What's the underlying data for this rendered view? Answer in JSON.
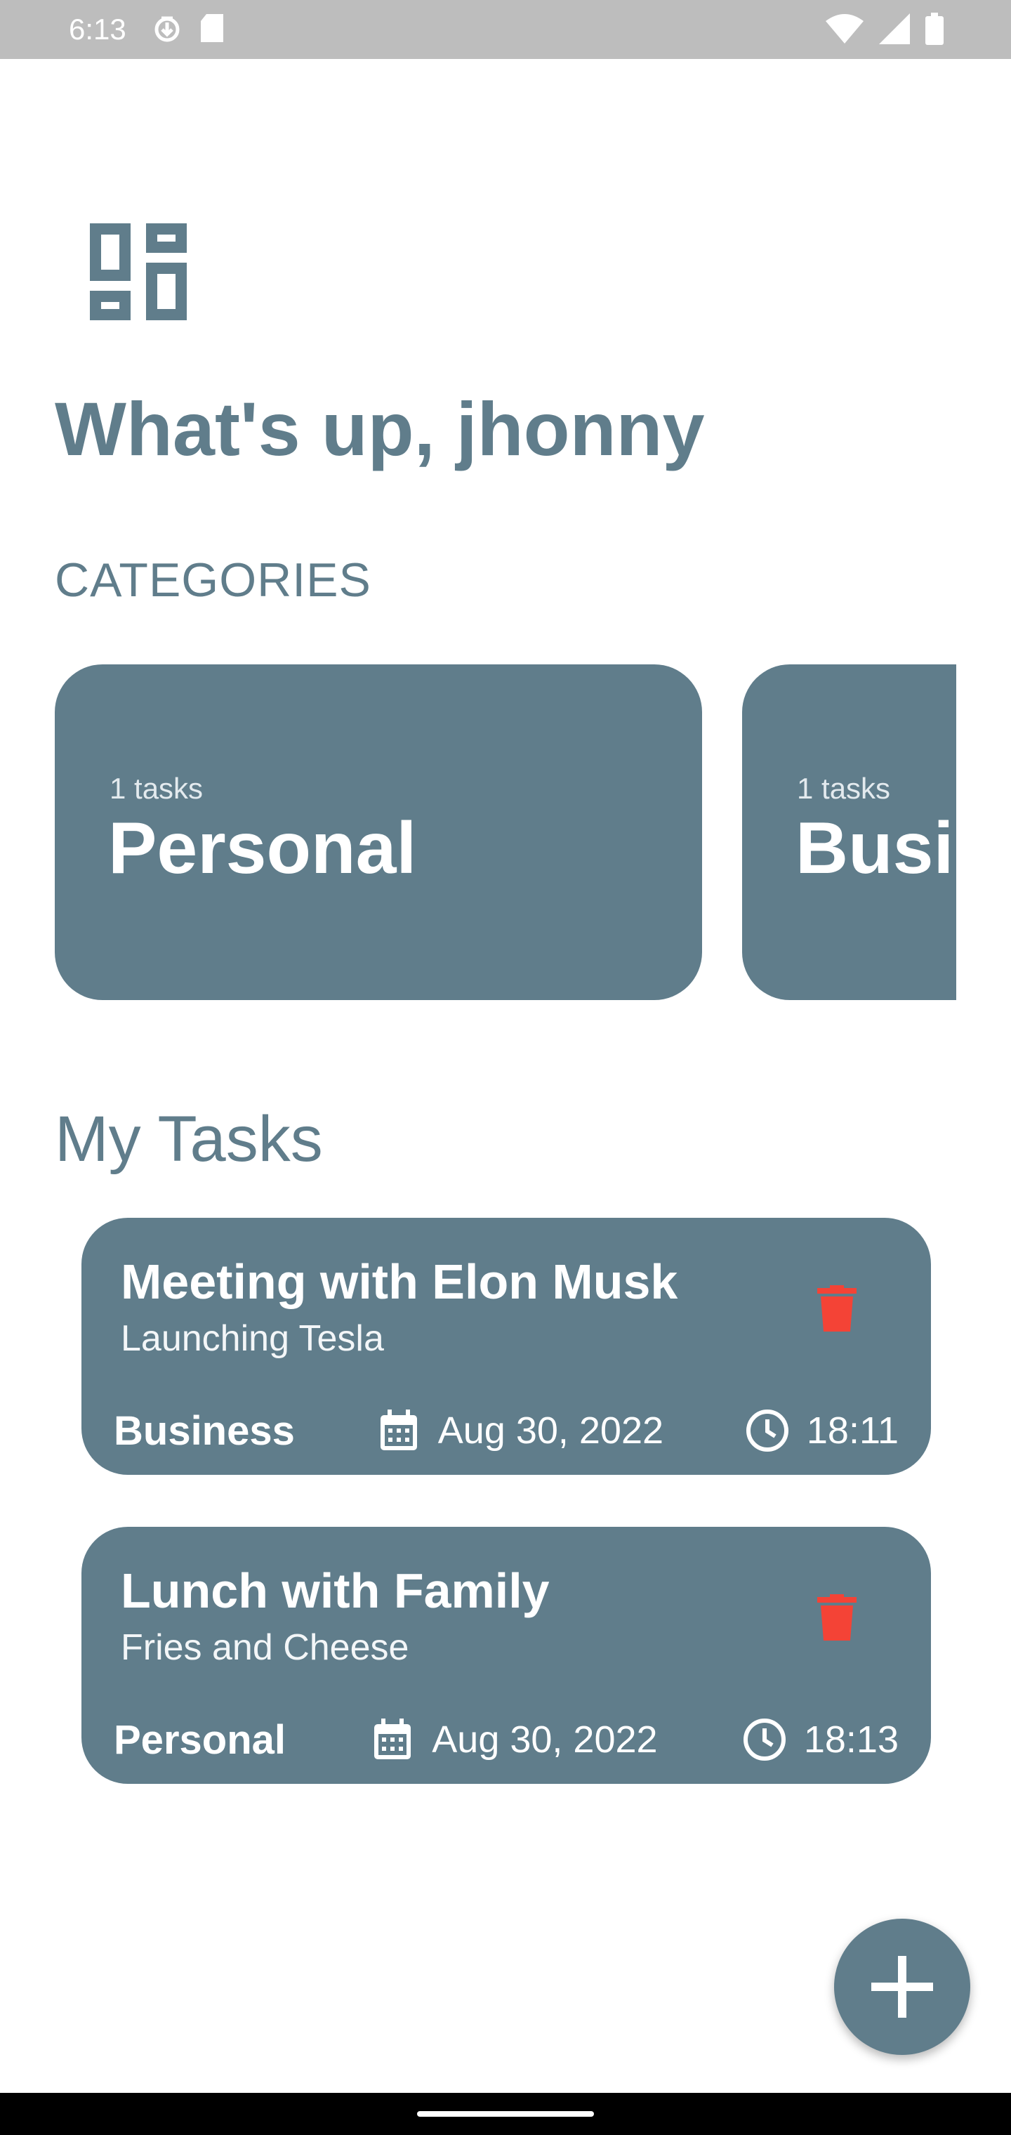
{
  "status_bar": {
    "time": "6:13",
    "left_icons": [
      "download-status-icon",
      "sd-card-icon"
    ],
    "right_icons": [
      "wifi-icon",
      "cell-signal-icon",
      "battery-icon"
    ]
  },
  "header": {
    "logo_icon": "dashboard-icon",
    "greeting": "What's up, jhonny",
    "categories_label": "CATEGORIES"
  },
  "categories": [
    {
      "count": "1 tasks",
      "name": "Personal"
    },
    {
      "count": "1 tasks",
      "name": "Business"
    }
  ],
  "tasks_section": {
    "heading": "My Tasks",
    "items": [
      {
        "title": "Meeting with Elon Musk",
        "description": "Launching Tesla",
        "category": "Business",
        "date": "Aug 30, 2022",
        "time": "18:11"
      },
      {
        "title": "Lunch with Family",
        "description": "Fries and Cheese",
        "category": "Personal",
        "date": "Aug 30, 2022",
        "time": "18:13"
      }
    ]
  },
  "fab": {
    "icon": "plus-icon"
  },
  "colors": {
    "primary": "#607d8b",
    "delete": "#f44336",
    "status_bar": "#bdbdbd",
    "background": "#ffffff"
  }
}
